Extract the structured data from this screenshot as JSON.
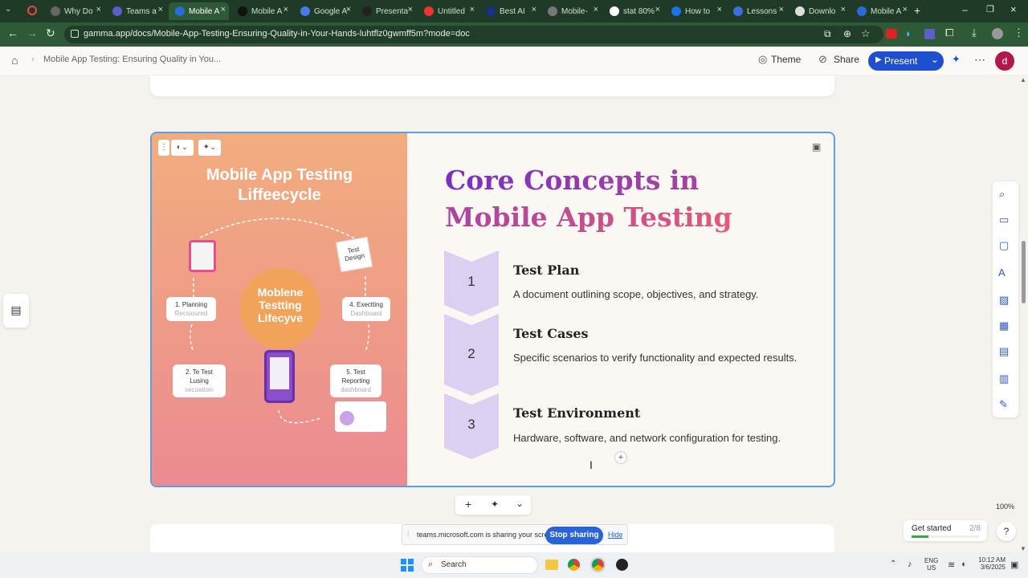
{
  "tabs": [
    {
      "label": "Why Do"
    },
    {
      "label": "Teams a"
    },
    {
      "label": "Mobile A"
    },
    {
      "label": "Mobile A"
    },
    {
      "label": "Google A"
    },
    {
      "label": "Presenta"
    },
    {
      "label": "Untitled"
    },
    {
      "label": "Best AI"
    },
    {
      "label": "Mobile-"
    },
    {
      "label": "stat 80%"
    },
    {
      "label": "How to"
    },
    {
      "label": "Lessons"
    },
    {
      "label": "Downlo"
    },
    {
      "label": "Mobile A"
    }
  ],
  "url": "gamma.app/docs/Mobile-App-Testing-Ensuring-Quality-in-Your-Hands-luhtflz0gwmff5m?mode=doc",
  "appbar": {
    "doc_title": "Mobile App Testing: Ensuring Quality in You...",
    "theme": "Theme",
    "share": "Share",
    "present": "Present",
    "avatar": "d"
  },
  "image": {
    "title_line1": "Mobile App Testing",
    "title_line2": "Liffeecycle",
    "center": "Moblene Testting Lifecyve",
    "planning": "1. Planning",
    "planning_sub": "Recisoured",
    "executing": "4. Exectting",
    "executing_sub": "Dashboard",
    "testusing": "2. Te Test Lusing",
    "testusing_sub": "secuatioin",
    "reporting": "5. Test Reporting",
    "reporting_sub": "dashboard",
    "design": "Test Design"
  },
  "slide": {
    "heading": "Core Concepts in Mobile App Testing",
    "items": [
      {
        "num": "1",
        "title": "Test Plan",
        "desc": "A document outlining scope, objectives, and strategy."
      },
      {
        "num": "2",
        "title": "Test Cases",
        "desc": "Specific scenarios to verify functionality and expected results."
      },
      {
        "num": "3",
        "title": "Test Environment",
        "desc": "Hardware, software, and network configuration for testing."
      }
    ]
  },
  "zoom": "100%",
  "get_started": "Get started",
  "get_started_progress": "2/8",
  "sharing": {
    "text": "teams.microsoft.com is sharing your screen.",
    "stop": "Stop sharing",
    "hide": "Hide"
  },
  "taskbar": {
    "search": "Search",
    "lang1": "ENG",
    "lang2": "US",
    "time": "10:12 AM",
    "date": "3/6/2025"
  },
  "colors": {
    "accent": "#1f4fd1",
    "chevron": "#dcd0f2",
    "heading_start": "#7a2fc0",
    "heading_end": "#e05a7a"
  }
}
